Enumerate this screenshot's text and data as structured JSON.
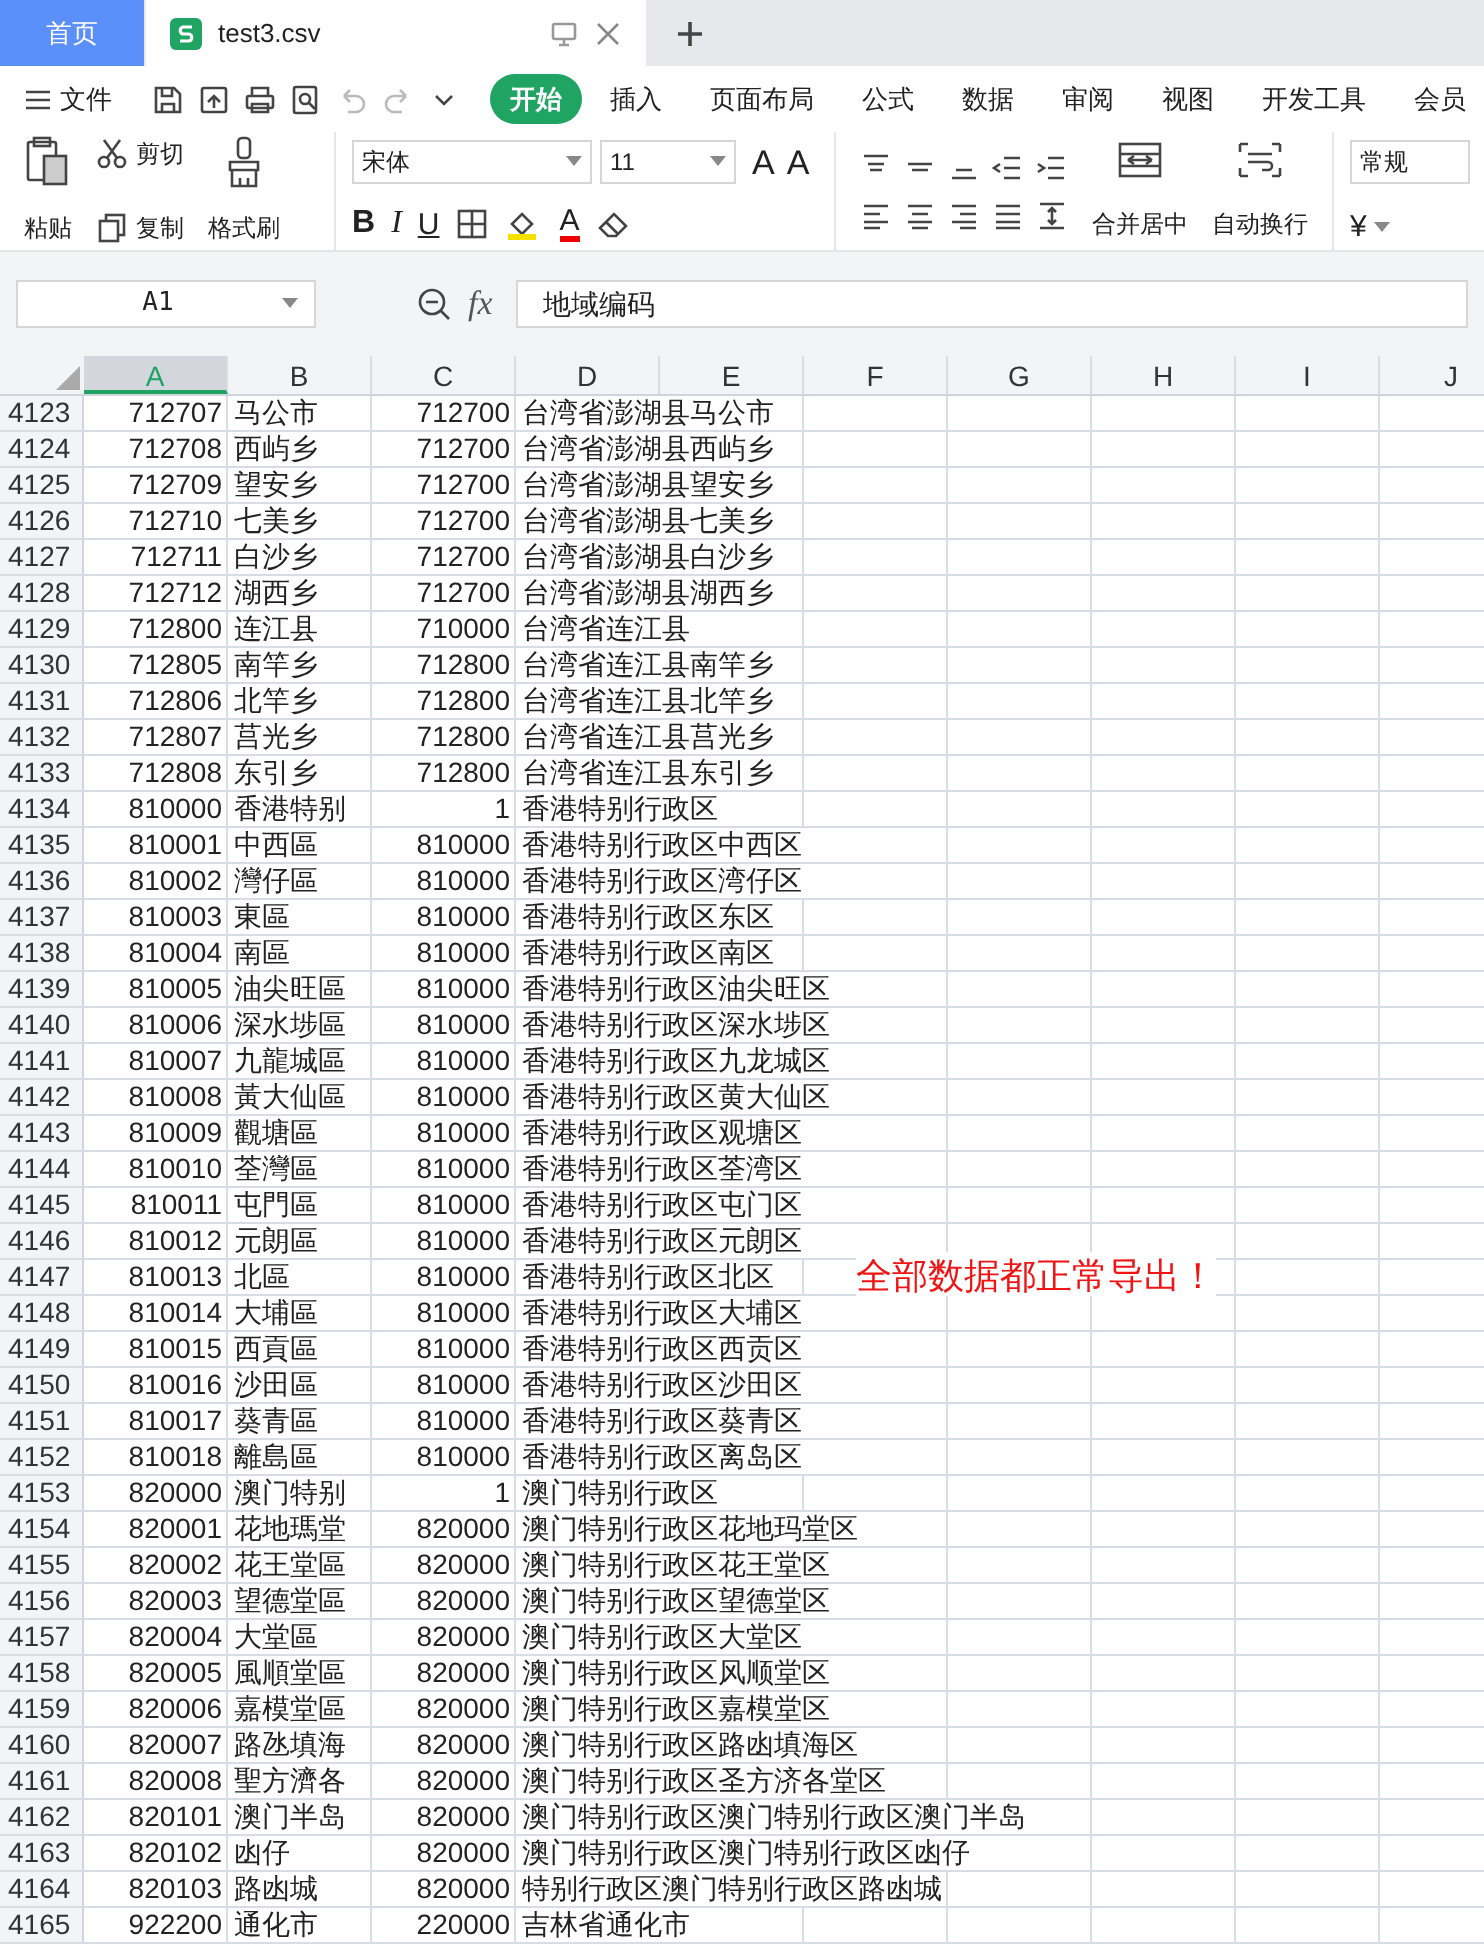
{
  "tabs": [
    {
      "label": "首页",
      "kind": "home",
      "selected": false
    },
    {
      "label": "test3.csv",
      "kind": "file",
      "selected": true
    }
  ],
  "menu": {
    "file": "文件",
    "tabs": [
      {
        "label": "开始",
        "selected": true
      },
      {
        "label": "插入",
        "selected": false
      },
      {
        "label": "页面布局",
        "selected": false
      },
      {
        "label": "公式",
        "selected": false
      },
      {
        "label": "数据",
        "selected": false
      },
      {
        "label": "审阅",
        "selected": false
      },
      {
        "label": "视图",
        "selected": false
      },
      {
        "label": "开发工具",
        "selected": false
      },
      {
        "label": "会员",
        "selected": false
      }
    ]
  },
  "ribbon": {
    "paste": "粘贴",
    "cut": "剪切",
    "copy": "复制",
    "format_painter": "格式刷",
    "font": "宋体",
    "font_size": "11",
    "grow": "A",
    "shrink": "A",
    "bold": "B",
    "italic": "I",
    "underline": "U",
    "font_color": "A",
    "merge": "合并居中",
    "wrap": "自动换行",
    "number_format": "常规",
    "currency": "¥"
  },
  "formula_bar": {
    "cell": "A1",
    "fx": "fx",
    "value": "地域编码"
  },
  "columns": [
    {
      "label": "A",
      "selected": true
    },
    {
      "label": "B",
      "selected": false
    },
    {
      "label": "C",
      "selected": false
    },
    {
      "label": "D",
      "selected": false
    },
    {
      "label": "E",
      "selected": false
    },
    {
      "label": "F",
      "selected": false
    },
    {
      "label": "G",
      "selected": false
    },
    {
      "label": "H",
      "selected": false
    },
    {
      "label": "I",
      "selected": false
    },
    {
      "label": "J",
      "selected": false
    }
  ],
  "rows": [
    {
      "n": "4123",
      "cells": [
        "712707",
        "马公市",
        "712700",
        "台湾省澎湖县马公市"
      ]
    },
    {
      "n": "4124",
      "cells": [
        "712708",
        "西屿乡",
        "712700",
        "台湾省澎湖县西屿乡"
      ]
    },
    {
      "n": "4125",
      "cells": [
        "712709",
        "望安乡",
        "712700",
        "台湾省澎湖县望安乡"
      ]
    },
    {
      "n": "4126",
      "cells": [
        "712710",
        "七美乡",
        "712700",
        "台湾省澎湖县七美乡"
      ]
    },
    {
      "n": "4127",
      "cells": [
        "712711",
        "白沙乡",
        "712700",
        "台湾省澎湖县白沙乡"
      ]
    },
    {
      "n": "4128",
      "cells": [
        "712712",
        "湖西乡",
        "712700",
        "台湾省澎湖县湖西乡"
      ]
    },
    {
      "n": "4129",
      "cells": [
        "712800",
        "连江县",
        "710000",
        "台湾省连江县"
      ]
    },
    {
      "n": "4130",
      "cells": [
        "712805",
        "南竿乡",
        "712800",
        "台湾省连江县南竿乡"
      ]
    },
    {
      "n": "4131",
      "cells": [
        "712806",
        "北竿乡",
        "712800",
        "台湾省连江县北竿乡"
      ]
    },
    {
      "n": "4132",
      "cells": [
        "712807",
        "莒光乡",
        "712800",
        "台湾省连江县莒光乡"
      ]
    },
    {
      "n": "4133",
      "cells": [
        "712808",
        "东引乡",
        "712800",
        "台湾省连江县东引乡"
      ]
    },
    {
      "n": "4134",
      "cells": [
        "810000",
        "香港特别",
        "1",
        "香港特别行政区"
      ]
    },
    {
      "n": "4135",
      "cells": [
        "810001",
        "中西區",
        "810000",
        "香港特别行政区中西区"
      ]
    },
    {
      "n": "4136",
      "cells": [
        "810002",
        "灣仔區",
        "810000",
        "香港特别行政区湾仔区"
      ]
    },
    {
      "n": "4137",
      "cells": [
        "810003",
        "東區",
        "810000",
        "香港特别行政区东区"
      ]
    },
    {
      "n": "4138",
      "cells": [
        "810004",
        "南區",
        "810000",
        "香港特别行政区南区"
      ]
    },
    {
      "n": "4139",
      "cells": [
        "810005",
        "油尖旺區",
        "810000",
        "香港特别行政区油尖旺区"
      ]
    },
    {
      "n": "4140",
      "cells": [
        "810006",
        "深水埗區",
        "810000",
        "香港特别行政区深水埗区"
      ]
    },
    {
      "n": "4141",
      "cells": [
        "810007",
        "九龍城區",
        "810000",
        "香港特别行政区九龙城区"
      ]
    },
    {
      "n": "4142",
      "cells": [
        "810008",
        "黃大仙區",
        "810000",
        "香港特别行政区黄大仙区"
      ]
    },
    {
      "n": "4143",
      "cells": [
        "810009",
        "觀塘區",
        "810000",
        "香港特别行政区观塘区"
      ]
    },
    {
      "n": "4144",
      "cells": [
        "810010",
        "荃灣區",
        "810000",
        "香港特别行政区荃湾区"
      ]
    },
    {
      "n": "4145",
      "cells": [
        "810011",
        "屯門區",
        "810000",
        "香港特别行政区屯门区"
      ]
    },
    {
      "n": "4146",
      "cells": [
        "810012",
        "元朗區",
        "810000",
        "香港特别行政区元朗区"
      ]
    },
    {
      "n": "4147",
      "cells": [
        "810013",
        "北區",
        "810000",
        "香港特别行政区北区"
      ],
      "note": "全部数据都正常导出！"
    },
    {
      "n": "4148",
      "cells": [
        "810014",
        "大埔區",
        "810000",
        "香港特别行政区大埔区"
      ]
    },
    {
      "n": "4149",
      "cells": [
        "810015",
        "西貢區",
        "810000",
        "香港特别行政区西贡区"
      ]
    },
    {
      "n": "4150",
      "cells": [
        "810016",
        "沙田區",
        "810000",
        "香港特别行政区沙田区"
      ]
    },
    {
      "n": "4151",
      "cells": [
        "810017",
        "葵青區",
        "810000",
        "香港特别行政区葵青区"
      ]
    },
    {
      "n": "4152",
      "cells": [
        "810018",
        "離島區",
        "810000",
        "香港特别行政区离岛区"
      ]
    },
    {
      "n": "4153",
      "cells": [
        "820000",
        "澳门特别",
        "1",
        "澳门特别行政区"
      ]
    },
    {
      "n": "4154",
      "cells": [
        "820001",
        "花地瑪堂",
        "820000",
        "澳门特别行政区花地玛堂区"
      ]
    },
    {
      "n": "4155",
      "cells": [
        "820002",
        "花王堂區",
        "820000",
        "澳门特别行政区花王堂区"
      ]
    },
    {
      "n": "4156",
      "cells": [
        "820003",
        "望德堂區",
        "820000",
        "澳门特别行政区望德堂区"
      ]
    },
    {
      "n": "4157",
      "cells": [
        "820004",
        "大堂區",
        "820000",
        "澳门特别行政区大堂区"
      ]
    },
    {
      "n": "4158",
      "cells": [
        "820005",
        "風順堂區",
        "820000",
        "澳门特别行政区风顺堂区"
      ]
    },
    {
      "n": "4159",
      "cells": [
        "820006",
        "嘉模堂區",
        "820000",
        "澳门特别行政区嘉模堂区"
      ]
    },
    {
      "n": "4160",
      "cells": [
        "820007",
        "路氹填海",
        "820000",
        "澳门特别行政区路凼填海区"
      ]
    },
    {
      "n": "4161",
      "cells": [
        "820008",
        "聖方濟各",
        "820000",
        "澳门特别行政区圣方济各堂区"
      ]
    },
    {
      "n": "4162",
      "cells": [
        "820101",
        "澳门半岛",
        "820000",
        "澳门特别行政区澳门特别行政区澳门半岛"
      ]
    },
    {
      "n": "4163",
      "cells": [
        "820102",
        "凼仔",
        "820000",
        "澳门特别行政区澳门特别行政区凼仔"
      ]
    },
    {
      "n": "4164",
      "cells": [
        "820103",
        "路凼城",
        "820000",
        "特别行政区澳门特别行政区路凼城"
      ]
    },
    {
      "n": "4165",
      "cells": [
        "922200",
        "通化市",
        "220000",
        "吉林省通化市"
      ]
    }
  ]
}
